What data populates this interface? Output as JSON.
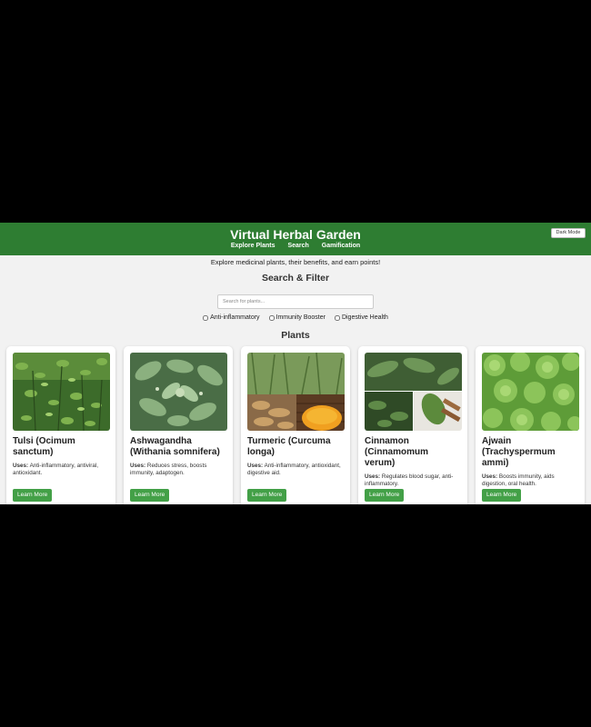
{
  "header": {
    "title": "Virtual Herbal Garden",
    "nav": [
      "Explore Plants",
      "Search",
      "Gamification"
    ],
    "dark_mode_label": "Dark Mode"
  },
  "tagline": "Explore medicinal plants, their benefits, and earn points!",
  "search": {
    "title": "Search & Filter",
    "placeholder": "Search for plants...",
    "filters": [
      "Anti-inflammatory",
      "Immunity Booster",
      "Digestive Health"
    ]
  },
  "plants": {
    "title": "Plants",
    "uses_label": "Uses:",
    "button_label": "Learn More",
    "items": [
      {
        "name": "Tulsi (Ocimum sanctum)",
        "uses": "Anti-inflammatory, antiviral, antioxidant."
      },
      {
        "name": "Ashwagandha (Withania somnifera)",
        "uses": "Reduces stress, boosts immunity, adaptogen."
      },
      {
        "name": "Turmeric (Curcuma longa)",
        "uses": "Anti-inflammatory, antioxidant, digestive aid."
      },
      {
        "name": "Cinnamon (Cinnamomum verum)",
        "uses": "Regulates blood sugar, anti-inflammatory."
      },
      {
        "name": "Ajwain (Trachyspermum ammi)",
        "uses": "Boosts immunity, aids digestion, oral health."
      }
    ]
  },
  "colors": {
    "header_bg": "#2e7d32",
    "button_bg": "#43a047",
    "page_bg": "#f2f2f2"
  }
}
